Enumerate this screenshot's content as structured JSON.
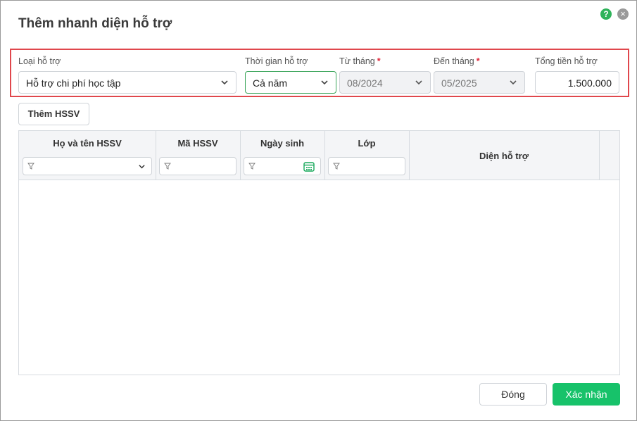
{
  "dialog": {
    "title": "Thêm nhanh diện hỗ trợ",
    "help_icon_glyph": "?",
    "close_icon_glyph": "×"
  },
  "form": {
    "support_type": {
      "label": "Loại hỗ trợ",
      "value": "Hỗ trợ chi phí học tập"
    },
    "support_period": {
      "label": "Thời gian hỗ trợ",
      "value": "Cả năm"
    },
    "from_month": {
      "label": "Từ tháng",
      "required_mark": "*",
      "value": "08/2024"
    },
    "to_month": {
      "label": "Đến tháng",
      "required_mark": "*",
      "value": "05/2025"
    },
    "total_amount": {
      "label": "Tổng tiền hỗ trợ",
      "value": "1.500.000"
    }
  },
  "toolbar": {
    "add_student_label": "Thêm HSSV"
  },
  "table": {
    "columns": [
      {
        "label": "Họ và tên HSSV"
      },
      {
        "label": "Mã HSSV"
      },
      {
        "label": "Ngày sinh"
      },
      {
        "label": "Lớp"
      },
      {
        "label": "Diện hỗ trợ"
      }
    ],
    "rows": []
  },
  "footer": {
    "close_label": "Đóng",
    "confirm_label": "Xác nhận"
  },
  "colors": {
    "accent": "#17c26a",
    "highlight_border": "#e0474c",
    "required": "#e0283b"
  },
  "icons": [
    "help-icon",
    "close-icon",
    "chevron-down-icon",
    "filter-icon",
    "calendar-icon"
  ]
}
